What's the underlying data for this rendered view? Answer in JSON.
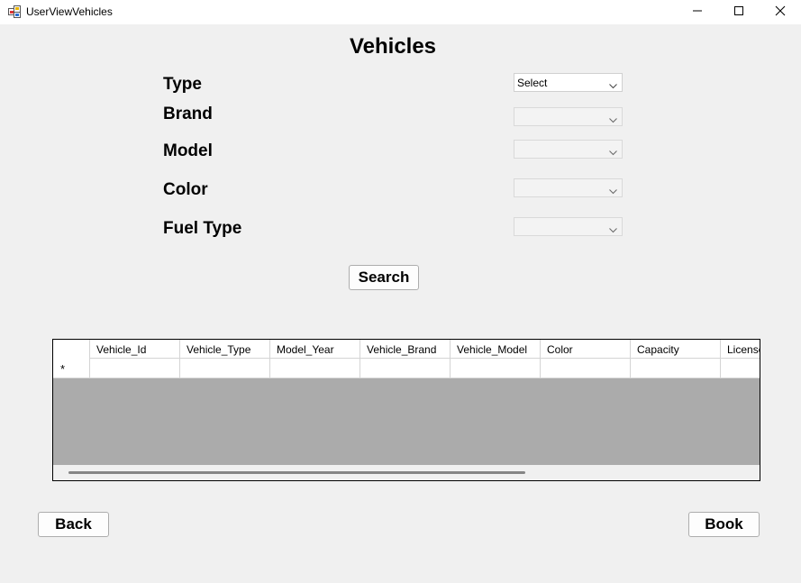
{
  "window": {
    "title": "UserViewVehicles"
  },
  "heading": "Vehicles",
  "filters": [
    {
      "label": "Type",
      "value": "Select"
    },
    {
      "label": "Brand",
      "value": ""
    },
    {
      "label": "Model",
      "value": ""
    },
    {
      "label": "Color",
      "value": ""
    },
    {
      "label": "Fuel Type",
      "value": ""
    }
  ],
  "buttons": {
    "search": "Search",
    "back": "Back",
    "book": "Book"
  },
  "grid": {
    "columns": [
      "Vehicle_Id",
      "Vehicle_Type",
      "Model_Year",
      "Vehicle_Brand",
      "Vehicle_Model",
      "Color",
      "Capacity",
      "License"
    ],
    "new_row_marker": "*"
  },
  "icons": {
    "app": "app-window-icon",
    "minimize": "minimize-icon",
    "maximize": "maximize-icon",
    "close": "close-icon",
    "dropdown": "chevron-down-icon"
  }
}
